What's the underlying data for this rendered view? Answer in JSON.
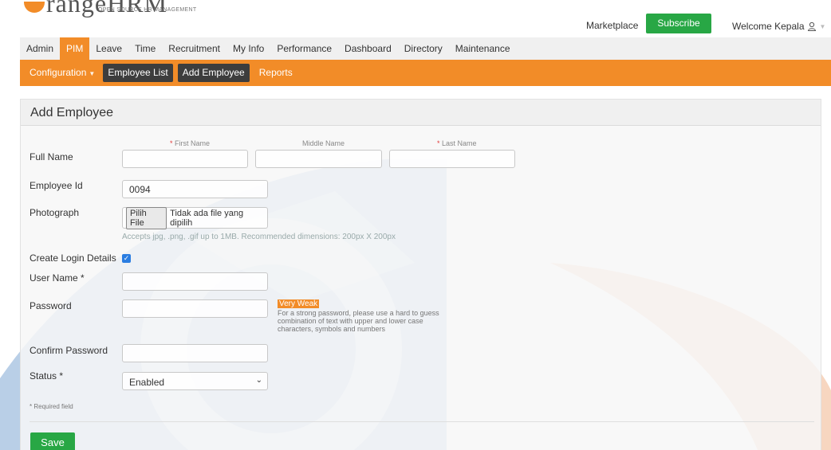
{
  "header": {
    "logo_word": "rangeHRM",
    "logo_brand": "HRM",
    "logo_tagline": "OPEN SOURCE HR MANAGEMENT",
    "marketplace": "Marketplace",
    "subscribe": "Subscribe",
    "welcome": "Welcome Kepala"
  },
  "main_menu": {
    "items": [
      {
        "label": "Admin"
      },
      {
        "label": "PIM",
        "active": true
      },
      {
        "label": "Leave"
      },
      {
        "label": "Time"
      },
      {
        "label": "Recruitment"
      },
      {
        "label": "My Info"
      },
      {
        "label": "Performance"
      },
      {
        "label": "Dashboard"
      },
      {
        "label": "Directory"
      },
      {
        "label": "Maintenance"
      }
    ]
  },
  "sub_menu": {
    "configuration": "Configuration",
    "employee_list": "Employee List",
    "add_employee": "Add Employee",
    "reports": "Reports"
  },
  "form": {
    "title": "Add Employee",
    "full_name_label": "Full Name",
    "first_name_label": "First Name",
    "middle_name_label": "Middle Name",
    "last_name_label": "Last Name",
    "required_mark": "* ",
    "employee_id_label": "Employee Id",
    "employee_id_value": "0094",
    "photograph_label": "Photograph",
    "file_button": "Pilih File",
    "file_status": "Tidak ada file yang dipilih",
    "photo_hint": "Accepts jpg, .png, .gif up to 1MB. Recommended dimensions: 200px X 200px",
    "create_login_label": "Create Login Details",
    "create_login_checked": true,
    "username_label": "User Name *",
    "password_label": "Password",
    "password_strength": "Very Weak",
    "password_help": "For a strong password, please use a hard to guess combination of text with upper and lower case characters, symbols and numbers",
    "confirm_password_label": "Confirm Password",
    "status_label": "Status *",
    "status_value": "Enabled",
    "required_note": "* Required field",
    "save": "Save"
  },
  "colors": {
    "accent_orange": "#f28c28",
    "accent_green": "#28a745",
    "watermark_blue": "#5b8ec6",
    "watermark_peach": "#f0b48a"
  }
}
